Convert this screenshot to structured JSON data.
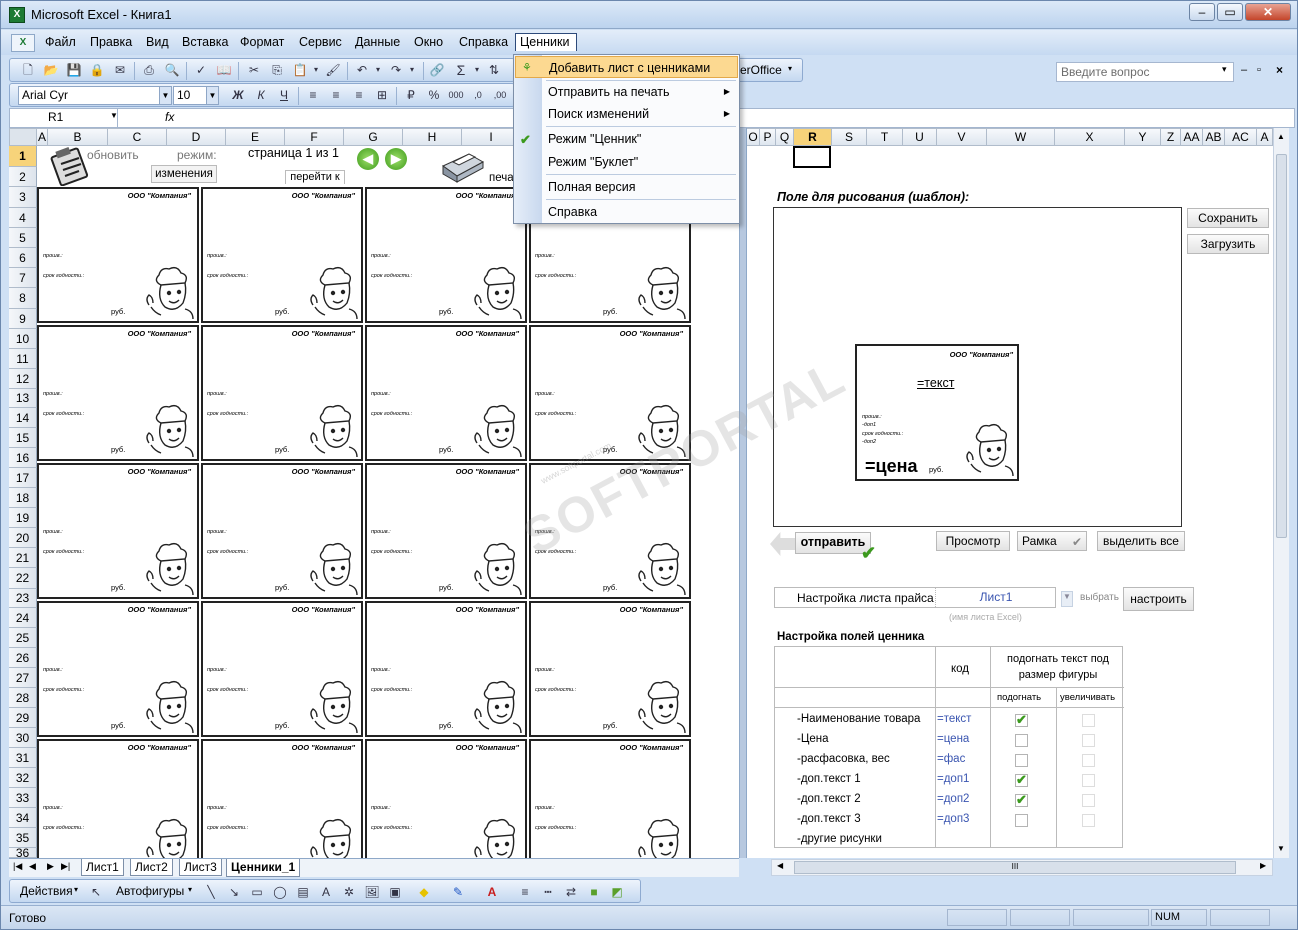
{
  "window": {
    "title": "Microsoft Excel - Книга1",
    "icon": "excel-icon"
  },
  "menu": {
    "items": [
      "Файл",
      "Правка",
      "Вид",
      "Вставка",
      "Формат",
      "Сервис",
      "Данные",
      "Окно",
      "Справка",
      "Ценники"
    ],
    "ask_placeholder": "Введите вопрос"
  },
  "toolbar": {
    "font": "Arial Cyr",
    "size": "10",
    "openoffice_label": "erOffice"
  },
  "namebox": "R1",
  "fx": "fx",
  "columns_left": [
    "A",
    "B",
    "C",
    "D",
    "E",
    "F",
    "G",
    "H",
    "I"
  ],
  "columns_right": [
    "O",
    "P",
    "Q",
    "R",
    "S",
    "T",
    "U",
    "V",
    "W",
    "X",
    "Y",
    "Z",
    "AA",
    "AB",
    "AC",
    "A"
  ],
  "rows": [
    "1",
    "2",
    "3",
    "4",
    "5",
    "6",
    "7",
    "8",
    "9",
    "10",
    "11",
    "12",
    "13",
    "14",
    "15",
    "16",
    "17",
    "18",
    "19",
    "20",
    "21",
    "22",
    "23",
    "24",
    "25",
    "26",
    "27",
    "28",
    "29",
    "30",
    "31",
    "32",
    "33",
    "34",
    "35",
    "36"
  ],
  "sheet_top": {
    "update_label": "обновить",
    "mode_label": "режим:",
    "mode_value": "изменения",
    "page_label": "страница 1 из 1",
    "goto_label": "перейти к",
    "print_label": "печат"
  },
  "card": {
    "company": "ООО \"Компания\"",
    "price_line": "прошв.:",
    "expiry_line": "срок годности.:",
    "currency": "руб."
  },
  "dropdown": {
    "items": [
      {
        "label": "Добавить лист с ценниками"
      },
      {
        "label": "Отправить на печать"
      },
      {
        "label": "Поиск изменений"
      },
      {
        "label": "Режим \"Ценник\""
      },
      {
        "label": "Режим \"Буклет\""
      },
      {
        "label": "Полная версия"
      },
      {
        "label": "Справка"
      }
    ]
  },
  "right": {
    "draw_title": "Поле для рисования (шаблон):",
    "save": "Сохранить",
    "load": "Загрузить",
    "tpl_company": "ООО \"Компания\"",
    "tpl_text": "=текст",
    "tpl_l1": "прошв.:",
    "tpl_l2": "-доп1",
    "tpl_l3": "срок годности.:",
    "tpl_l4": "-доп2",
    "tpl_price": "=цена",
    "tpl_rub": "руб.",
    "send": "отправить",
    "preview": "Просмотр",
    "frame": "Рамка",
    "select_all": "выделить все",
    "price_setting_label": "Настройка листа прайса",
    "price_sheet": "Лист1",
    "choose": "выбрать",
    "configure": "настроить",
    "sheet_hint": "(имя листа Excel)",
    "fields_title": "Настройка полей ценника",
    "col_code": "код",
    "col_fit": "подогнать текст под размер фигуры",
    "col_fit1": "подогнать",
    "col_fit2": "увеличивать",
    "fields": [
      {
        "name": "-Наименование товара",
        "code": "=текст",
        "fit": true
      },
      {
        "name": "-Цена",
        "code": "=цена",
        "fit": false
      },
      {
        "name": "-расфасовка, вес",
        "code": "=фас",
        "fit": false
      },
      {
        "name": "-доп.текст 1",
        "code": "=доп1",
        "fit": true
      },
      {
        "name": "-доп.текст 2",
        "code": "=доп2",
        "fit": true
      },
      {
        "name": "-доп.текст 3",
        "code": "=доп3",
        "fit": false
      },
      {
        "name": "-другие рисунки",
        "code": "",
        "fit": null
      }
    ]
  },
  "watermark": "SOFTPORTAL",
  "watermark_url": "www.softportal.com",
  "tabs": [
    "Лист1",
    "Лист2",
    "Лист3",
    "Ценники_1"
  ],
  "drawing": {
    "actions": "Действия",
    "autoshapes": "Автофигуры"
  },
  "status": {
    "ready": "Готово",
    "num": "NUM"
  }
}
